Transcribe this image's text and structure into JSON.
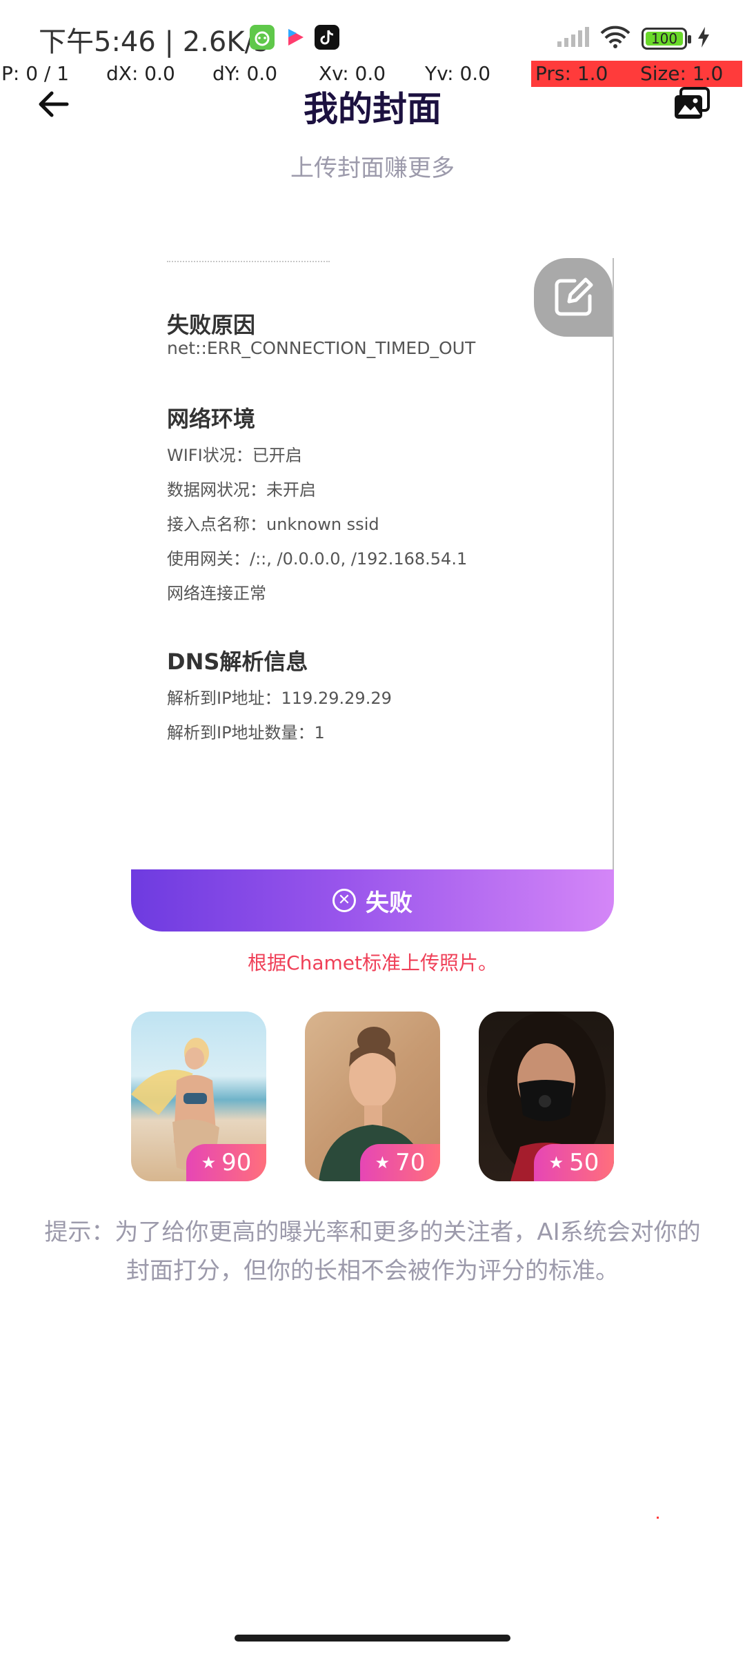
{
  "status_bar": {
    "time_and_speed": "下午5:46 | 2.6K/s",
    "battery": "100",
    "app_icons": [
      "android-icon",
      "video-app-icon",
      "tiktok-icon"
    ],
    "system_icons": [
      "signal-icon",
      "wifi-icon",
      "battery-icon",
      "charging-icon"
    ]
  },
  "debug": {
    "p": "P: 0 / 1",
    "dx": "dX: 0.0",
    "dy": "dY: 0.0",
    "xv": "Xv: 0.0",
    "yv": "Yv: 0.0",
    "prs": "Prs: 1.0",
    "size": "Size: 1.0",
    "highlight_color": "#ff3b3b"
  },
  "header": {
    "title": "我的封面",
    "subtitle": "上传封面赚更多",
    "back_icon": "arrow-left-icon",
    "gallery_icon": "gallery-icon"
  },
  "card": {
    "fail_reason_title": "失败原因",
    "fail_reason": "net::ERR_CONNECTION_TIMED_OUT",
    "network_title": "网络环境",
    "network_lines": [
      "WIFI状况：已开启",
      "数据网状况：未开启",
      "接入点名称：unknown ssid",
      "使用网关：/::, /0.0.0.0, /192.168.54.1",
      "网络连接正常"
    ],
    "dns_title": "DNS解析信息",
    "dns_lines": [
      "解析到IP地址：119.29.29.29",
      "解析到IP地址数量：1"
    ],
    "status_label": "失败",
    "edit_icon": "edit-icon"
  },
  "hint": "根据Chamet标准上传照片。",
  "samples": [
    {
      "score": "90"
    },
    {
      "score": "70"
    },
    {
      "score": "50"
    }
  ],
  "tip": "提示：为了给你更高的曝光率和更多的关注者，AI系统会对你的封面打分，但你的长相不会被作为评分的标准。",
  "colors": {
    "title": "#1c1140",
    "muted": "#9c9aab",
    "accent_start": "#6e3be0",
    "accent_end": "#d486f7",
    "error": "#ef3f57",
    "score_start": "#e646b5",
    "score_end": "#ff6f7c"
  }
}
